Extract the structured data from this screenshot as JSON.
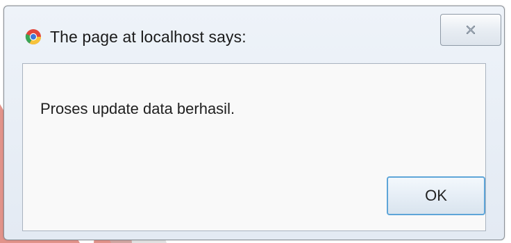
{
  "dialog": {
    "title": "The page at localhost says:",
    "message": "Proses update data berhasil.",
    "ok_label": "OK",
    "close_icon": "close-icon",
    "browser_icon": "chrome-icon"
  },
  "colors": {
    "dialog_bg": "#e3eaf3",
    "content_bg": "#f9f9f9",
    "ok_border": "#5ea5d8",
    "watermark": "#c83a2a"
  }
}
